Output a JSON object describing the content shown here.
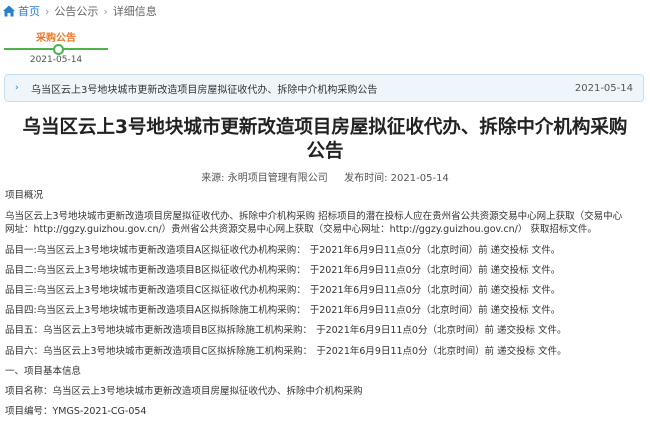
{
  "breadcrumb": {
    "home": "首页",
    "items": [
      "公告公示",
      "详细信息"
    ],
    "separator": "›"
  },
  "progress": {
    "step_label": "采购公告",
    "step_date": "2021-05-14"
  },
  "notice_bar": {
    "title": "乌当区云上3号地块城市更新改造项目房屋拟征收代办、拆除中介机构采购公告",
    "date": "2021-05-14"
  },
  "article": {
    "title_line1": "乌当区云上3号地块城市更新改造项目房屋拟征收代办、拆除中介机构采购",
    "title_line2": "公告",
    "source": "来源: 永明项目管理有限公司",
    "publish_time": "发布时间: 2021-05-14",
    "section_overview": "项目概况",
    "overview_line1": "乌当区云上3号地块城市更新改造项目房屋拟征收代办、拆除中介机构采购 招标项目的潜在投标人应在贵州省公共资源交易中心网上获取（交易中心",
    "overview_line2": "网址：http://ggzy.guizhou.gov.cn/）贵州省公共资源交易中心网上获取（交易中心网址：http://ggzy.guizhou.gov.cn/） 获取招标文件。",
    "items": [
      {
        "label": "品目一:乌当区云上3号地块城市更新改造项目A区拟征收代办机构采购：",
        "deadline": "于2021年6月9日11点0分（北京时间）前 递交投标 文件。"
      },
      {
        "label": "品目二:乌当区云上3号地块城市更新改造项目B区拟征收代办机构采购：",
        "deadline": "于2021年6月9日11点0分（北京时间）前 递交投标 文件。"
      },
      {
        "label": "品目三:乌当区云上3号地块城市更新改造项目C区拟征收代办机构采购：",
        "deadline": "于2021年6月9日11点0分（北京时间）前 递交投标 文件。"
      },
      {
        "label": "品目四:乌当区云上3号地块城市更新改造项目A区拟拆除施工机构采购：",
        "deadline": "于2021年6月9日11点0分（北京时间）前 递交投标 文件。"
      },
      {
        "label": "品目五：乌当区云上3号地块城市更新改造项目B区拟拆除施工机构采购：",
        "deadline": "于2021年6月9日11点0分（北京时间）前 递交投标 文件。"
      },
      {
        "label": "品目六：乌当区云上3号地块城市更新改造项目C区拟拆除施工机构采购：",
        "deadline": "于2021年6月9日11点0分（北京时间）前 递交投标 文件。"
      }
    ],
    "section_basic": "一、项目基本信息",
    "project_name": "项目名称：乌当区云上3号地块城市更新改造项目房屋拟征收代办、拆除中介机构采购",
    "project_code": "项目编号：YMGS-2021-CG-054"
  },
  "colors": {
    "link": "#2a7fc9",
    "accent_orange": "#e8792b",
    "progress_green": "#4fb24f",
    "notice_bg": "#eef6fb"
  }
}
